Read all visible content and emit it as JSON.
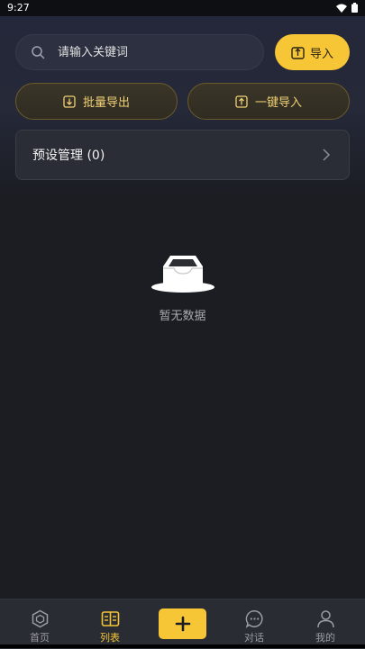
{
  "status_bar": {
    "time": "9:27"
  },
  "search": {
    "placeholder": "请输入关键词"
  },
  "actions": {
    "import_label": "导入",
    "batch_export_label": "批量导出",
    "one_click_import_label": "一键导入"
  },
  "preset": {
    "label": "预设管理 (0)"
  },
  "empty_state": {
    "text": "暂无数据"
  },
  "tabbar": {
    "home_label": "首页",
    "list_label": "列表",
    "chat_label": "对话",
    "mine_label": "我的",
    "active": "列表"
  },
  "colors": {
    "accent": "#f7c636",
    "background": "#1b1d23",
    "card": "#2a2d36",
    "outline_text": "#f0d175"
  },
  "icons": [
    "search-icon",
    "import-icon",
    "export-icon",
    "chevron-right-icon",
    "empty-inbox-icon",
    "home-icon",
    "list-icon",
    "plus-icon",
    "chat-icon",
    "profile-icon",
    "wifi-icon",
    "battery-icon"
  ]
}
